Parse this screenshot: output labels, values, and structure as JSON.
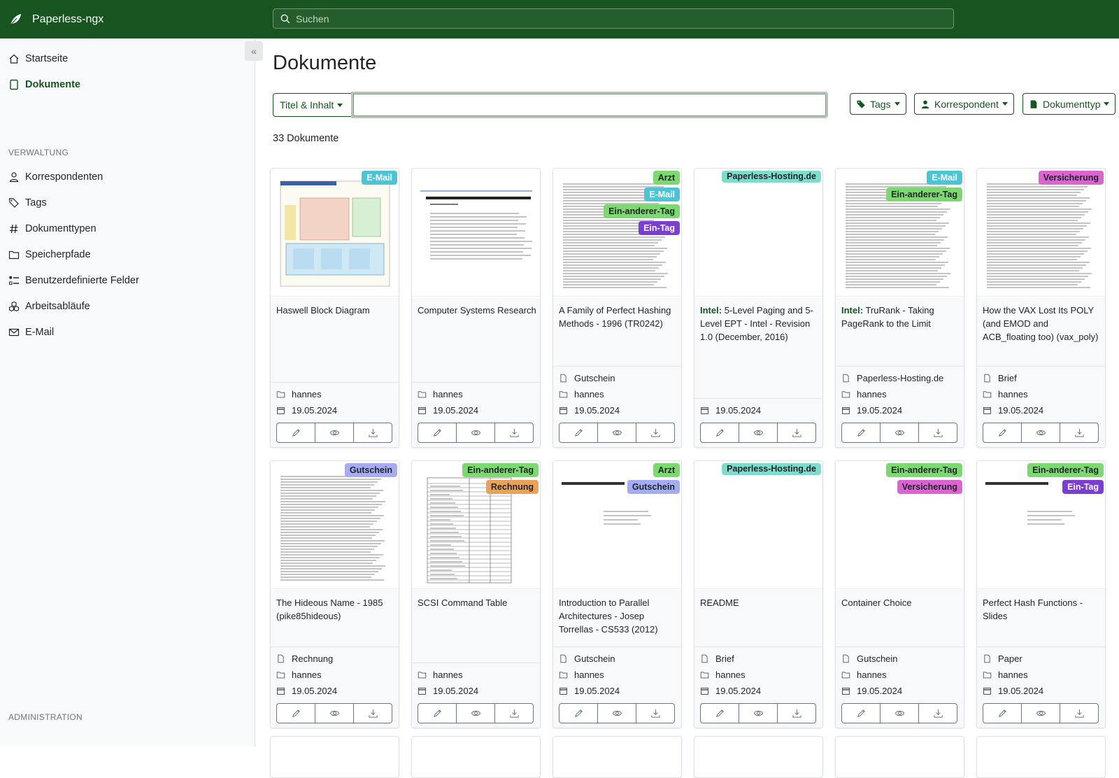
{
  "app": {
    "name": "Paperless-ngx"
  },
  "search": {
    "placeholder": "Suchen"
  },
  "sidebar": {
    "nav": [
      {
        "label": "Startseite",
        "icon": "house-icon"
      },
      {
        "label": "Dokumente",
        "icon": "file-icon",
        "active": true
      }
    ],
    "section_verwaltung": "VERWALTUNG",
    "manage": [
      {
        "label": "Korrespondenten",
        "icon": "person-icon"
      },
      {
        "label": "Tags",
        "icon": "tags-icon"
      },
      {
        "label": "Dokumenttypen",
        "icon": "hash-icon"
      },
      {
        "label": "Speicherpfade",
        "icon": "folder-icon"
      },
      {
        "label": "Benutzerdefinierte Felder",
        "icon": "ui-checks-icon"
      },
      {
        "label": "Arbeitsabläufe",
        "icon": "boxes-icon"
      },
      {
        "label": "E-Mail",
        "icon": "envelope-icon"
      }
    ],
    "section_administration": "ADMINISTRATION"
  },
  "main": {
    "title": "Dokumente",
    "filter": {
      "text_mode": "Titel & Inhalt",
      "text_value": "",
      "tags": "Tags",
      "correspondent": "Korrespondent",
      "document_type": "Dokumenttyp"
    },
    "count": "33 Dokumente"
  },
  "colors": {
    "primary": "#17541f",
    "tag_email": "#4fc3d6",
    "tag_arzt": "#7ed872",
    "tag_ein_anderer": "#7ed872",
    "tag_ein_tag": "#7b3fcf",
    "tag_hosting": "#7fdccb",
    "tag_versicherung": "#d966d0",
    "tag_gutschein": "#a6acf2",
    "tag_rechnung": "#e9a25a"
  },
  "documents": [
    {
      "title": "Haswell Block Diagram",
      "title_prefix": "",
      "doctype": "",
      "path": "hannes",
      "date": "19.05.2024",
      "tags": [
        {
          "label": "E-Mail",
          "bg": "#4fc3d6",
          "fg": "#ffffff"
        }
      ],
      "thumb": "diagram"
    },
    {
      "title": "Computer Systems Research",
      "title_prefix": "",
      "doctype": "",
      "path": "hannes",
      "date": "19.05.2024",
      "tags": [],
      "thumb": "paper"
    },
    {
      "title": "A Family of Perfect Hashing Methods - 1996 (TR0242)",
      "title_prefix": "",
      "doctype": "Gutschein",
      "path": "hannes",
      "date": "19.05.2024",
      "tags": [
        {
          "label": "Arzt",
          "bg": "#7ed872",
          "fg": "#212529"
        },
        {
          "label": "E-Mail",
          "bg": "#4fc3d6",
          "fg": "#ffffff"
        },
        {
          "label": "Ein-anderer-Tag",
          "bg": "#7ed872",
          "fg": "#212529"
        },
        {
          "label": "Ein-Tag",
          "bg": "#7b3fcf",
          "fg": "#ffffff"
        }
      ],
      "thumb": "text"
    },
    {
      "title": "5-Level Paging and 5-Level EPT - Intel - Revision 1.0 (December, 2016)",
      "title_prefix": "Intel:",
      "doctype": "",
      "path": "",
      "date": "19.05.2024",
      "tags": [
        {
          "label": "Paperless-Hosting.de",
          "bg": "#7fdccb",
          "fg": "#212529"
        }
      ],
      "thumb": "blank"
    },
    {
      "title": "TruRank - Taking PageRank to the Limit",
      "title_prefix": "Intel:",
      "doctype": "Paperless-Hosting.de",
      "path": "hannes",
      "date": "19.05.2024",
      "tags": [
        {
          "label": "E-Mail",
          "bg": "#4fc3d6",
          "fg": "#ffffff"
        },
        {
          "label": "Ein-anderer-Tag",
          "bg": "#7ed872",
          "fg": "#212529"
        }
      ],
      "thumb": "text"
    },
    {
      "title": "How the VAX Lost Its POLY (and EMOD and ACB_floating too) (vax_poly)",
      "title_prefix": "",
      "doctype": "Brief",
      "path": "hannes",
      "date": "19.05.2024",
      "tags": [
        {
          "label": "Versicherung",
          "bg": "#d966d0",
          "fg": "#212529"
        }
      ],
      "thumb": "text"
    },
    {
      "title": "The Hideous Name - 1985 (pike85hideous)",
      "title_prefix": "",
      "doctype": "Rechnung",
      "path": "hannes",
      "date": "19.05.2024",
      "tags": [
        {
          "label": "Gutschein",
          "bg": "#a6acf2",
          "fg": "#212529"
        }
      ],
      "thumb": "text"
    },
    {
      "title": "SCSI Command Table",
      "title_prefix": "",
      "doctype": "",
      "path": "hannes",
      "date": "19.05.2024",
      "tags": [
        {
          "label": "Ein-anderer-Tag",
          "bg": "#7ed872",
          "fg": "#212529"
        },
        {
          "label": "Rechnung",
          "bg": "#e9a25a",
          "fg": "#212529"
        }
      ],
      "thumb": "table"
    },
    {
      "title": "Introduction to Parallel Architectures - Josep Torrellas - CS533 (2012)",
      "title_prefix": "",
      "doctype": "Gutschein",
      "path": "hannes",
      "date": "19.05.2024",
      "tags": [
        {
          "label": "Arzt",
          "bg": "#7ed872",
          "fg": "#212529"
        },
        {
          "label": "Gutschein",
          "bg": "#a6acf2",
          "fg": "#212529"
        }
      ],
      "thumb": "slide"
    },
    {
      "title": "README",
      "title_prefix": "",
      "doctype": "Brief",
      "path": "hannes",
      "date": "19.05.2024",
      "tags": [
        {
          "label": "Paperless-Hosting.de",
          "bg": "#7fdccb",
          "fg": "#212529"
        }
      ],
      "thumb": "blank"
    },
    {
      "title": "Container Choice",
      "title_prefix": "",
      "doctype": "Gutschein",
      "path": "hannes",
      "date": "19.05.2024",
      "tags": [
        {
          "label": "Ein-anderer-Tag",
          "bg": "#7ed872",
          "fg": "#212529"
        },
        {
          "label": "Versicherung",
          "bg": "#d966d0",
          "fg": "#212529"
        }
      ],
      "thumb": "blank"
    },
    {
      "title": "Perfect Hash Functions - Slides",
      "title_prefix": "",
      "doctype": "Paper",
      "path": "hannes",
      "date": "19.05.2024",
      "tags": [
        {
          "label": "Ein-anderer-Tag",
          "bg": "#7ed872",
          "fg": "#212529"
        },
        {
          "label": "Ein-Tag",
          "bg": "#7b3fcf",
          "fg": "#ffffff"
        }
      ],
      "thumb": "slide"
    }
  ]
}
